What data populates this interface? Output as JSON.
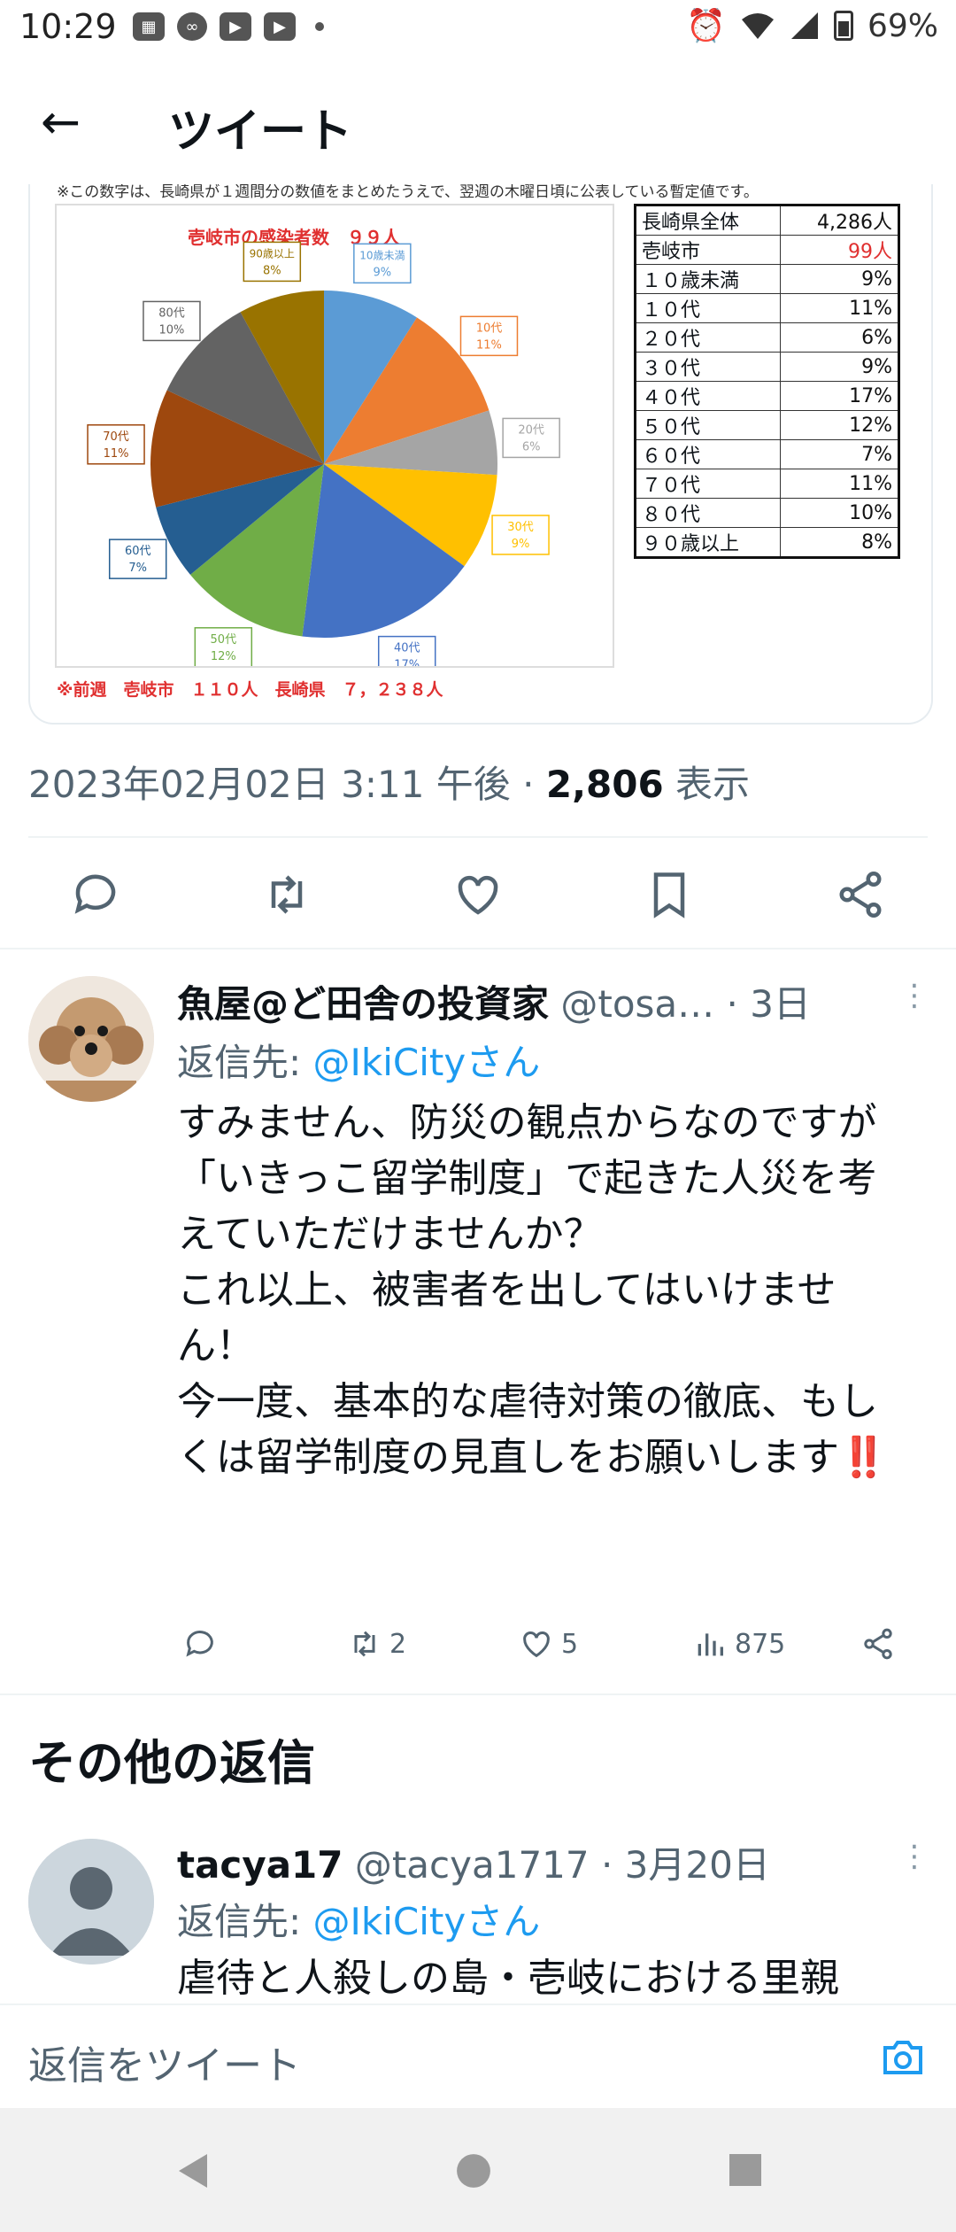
{
  "status": {
    "time": "10:29",
    "battery": "69%"
  },
  "header": {
    "title": "ツイート"
  },
  "tweet_image": {
    "note": "※この数字は、長崎県が１週間分の数値をまとめたうえで、翌週の木曜日頃に公表している暫定値です。",
    "previous_week": "※前週　壱岐市　１１０人　長崎県　７，２３８人",
    "chart_data": {
      "type": "pie",
      "title": "壱岐市の感染者数　９９人",
      "slices": [
        {
          "label": "10歳未満",
          "pct": "9%",
          "value": 9,
          "color": "#5b9bd5"
        },
        {
          "label": "10代",
          "pct": "11%",
          "value": 11,
          "color": "#ed7d31"
        },
        {
          "label": "20代",
          "pct": "6%",
          "value": 6,
          "color": "#a5a5a5"
        },
        {
          "label": "30代",
          "pct": "9%",
          "value": 9,
          "color": "#ffc000"
        },
        {
          "label": "40代",
          "pct": "17%",
          "value": 17,
          "color": "#4472c4"
        },
        {
          "label": "50代",
          "pct": "12%",
          "value": 12,
          "color": "#70ad47"
        },
        {
          "label": "60代",
          "pct": "7%",
          "value": 7,
          "color": "#255e91"
        },
        {
          "label": "70代",
          "pct": "11%",
          "value": 11,
          "color": "#9e480e"
        },
        {
          "label": "80代",
          "pct": "10%",
          "value": 10,
          "color": "#636363"
        },
        {
          "label": "90歳以上",
          "pct": "8%",
          "value": 8,
          "color": "#997300"
        }
      ]
    },
    "table": [
      {
        "label": "長崎県全体",
        "value": "4,286人",
        "color": "#111111"
      },
      {
        "label": "壱岐市",
        "value": "99人",
        "color": "#e03030"
      },
      {
        "label": "１０歳未満",
        "value": "9%",
        "color": "#111111"
      },
      {
        "label": "１０代",
        "value": "11%",
        "color": "#111111"
      },
      {
        "label": "２０代",
        "value": "6%",
        "color": "#111111"
      },
      {
        "label": "３０代",
        "value": "9%",
        "color": "#111111"
      },
      {
        "label": "４０代",
        "value": "17%",
        "color": "#111111"
      },
      {
        "label": "５０代",
        "value": "12%",
        "color": "#111111"
      },
      {
        "label": "６０代",
        "value": "7%",
        "color": "#111111"
      },
      {
        "label": "７０代",
        "value": "11%",
        "color": "#111111"
      },
      {
        "label": "８０代",
        "value": "10%",
        "color": "#111111"
      },
      {
        "label": "９０歳以上",
        "value": "8%",
        "color": "#111111"
      }
    ]
  },
  "tweet_meta": {
    "datetime": "2023年02月02日 3:11 午後 · ",
    "views": "2,806",
    "views_label": " 表示"
  },
  "reply1": {
    "name": "魚屋@ど田舎の投資家",
    "handle": " @tosa…",
    "time": " · 3日",
    "reply_to_prefix": "返信先: ",
    "reply_to": "@IkiCityさん",
    "text": "すみません、防災の観点からなのですが\n「いきっこ留学制度」で起きた人災を考えていただけませんか？\nこれ以上、被害者を出してはいけません！\n今一度、基本的な虐待対策の徹底、もしくは留学制度の見直しをお願いします",
    "emoji": "‼️",
    "retweets": "2",
    "likes": "5",
    "views": "875"
  },
  "section_title": "その他の返信",
  "reply2": {
    "name": "tacya17",
    "handle": " @tacya1717",
    "time": " · 3月20日",
    "reply_to_prefix": "返信先: ",
    "reply_to": "@IkiCityさん",
    "text": "虐待と人殺しの島・壱岐における里親"
  },
  "composer": {
    "placeholder": "返信をツイート"
  },
  "colors": {
    "accent": "#1d9bf0",
    "text": "#0f1419",
    "muted": "#536471"
  }
}
